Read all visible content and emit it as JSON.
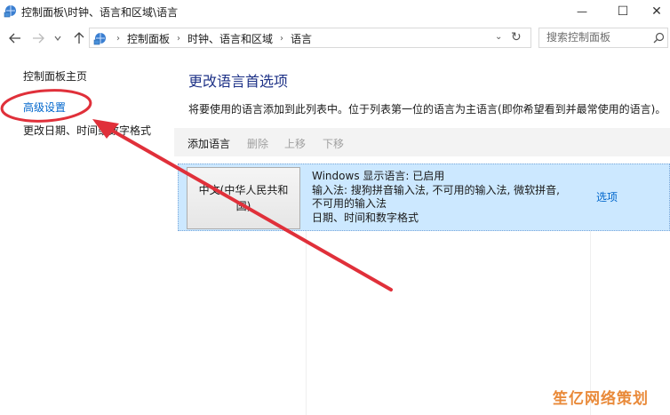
{
  "window": {
    "title": "控制面板\\时钟、语言和区域\\语言",
    "minimize_glyph": "—",
    "maximize_glyph": "☐",
    "close_glyph": "✕"
  },
  "nav": {
    "back_icon": "arrow-left-icon",
    "forward_icon": "arrow-right-icon",
    "up_icon": "arrow-up-icon",
    "breadcrumbs": [
      "控制面板",
      "时钟、语言和区域",
      "语言"
    ],
    "search_placeholder": "搜索控制面板"
  },
  "sidebar": {
    "home": "控制面板主页",
    "advanced": "高级设置",
    "date_time": "更改日期、时间或数字格式"
  },
  "main": {
    "title": "更改语言首选项",
    "description": "将要使用的语言添加到此列表中。位于列表第一位的语言为主语言(即你希望看到并最常使用的语言)。",
    "toolbar": {
      "add": "添加语言",
      "remove": "删除",
      "move_up": "上移",
      "move_down": "下移"
    },
    "languages": [
      {
        "name": "中文(中华人民共和国)",
        "info_line1": "Windows 显示语言: 已启用",
        "info_line2": "输入法: 搜狗拼音输入法, 不可用的输入法, 微软拼音,",
        "info_line3": "不可用的输入法",
        "info_line4": "日期、时间和数字格式",
        "options": "选项"
      }
    ]
  },
  "colors": {
    "link": "#0066cc",
    "title": "#1e3287",
    "selection": "#cce8ff",
    "annotation": "#e0303a"
  },
  "watermark": "笙亿网络策划"
}
